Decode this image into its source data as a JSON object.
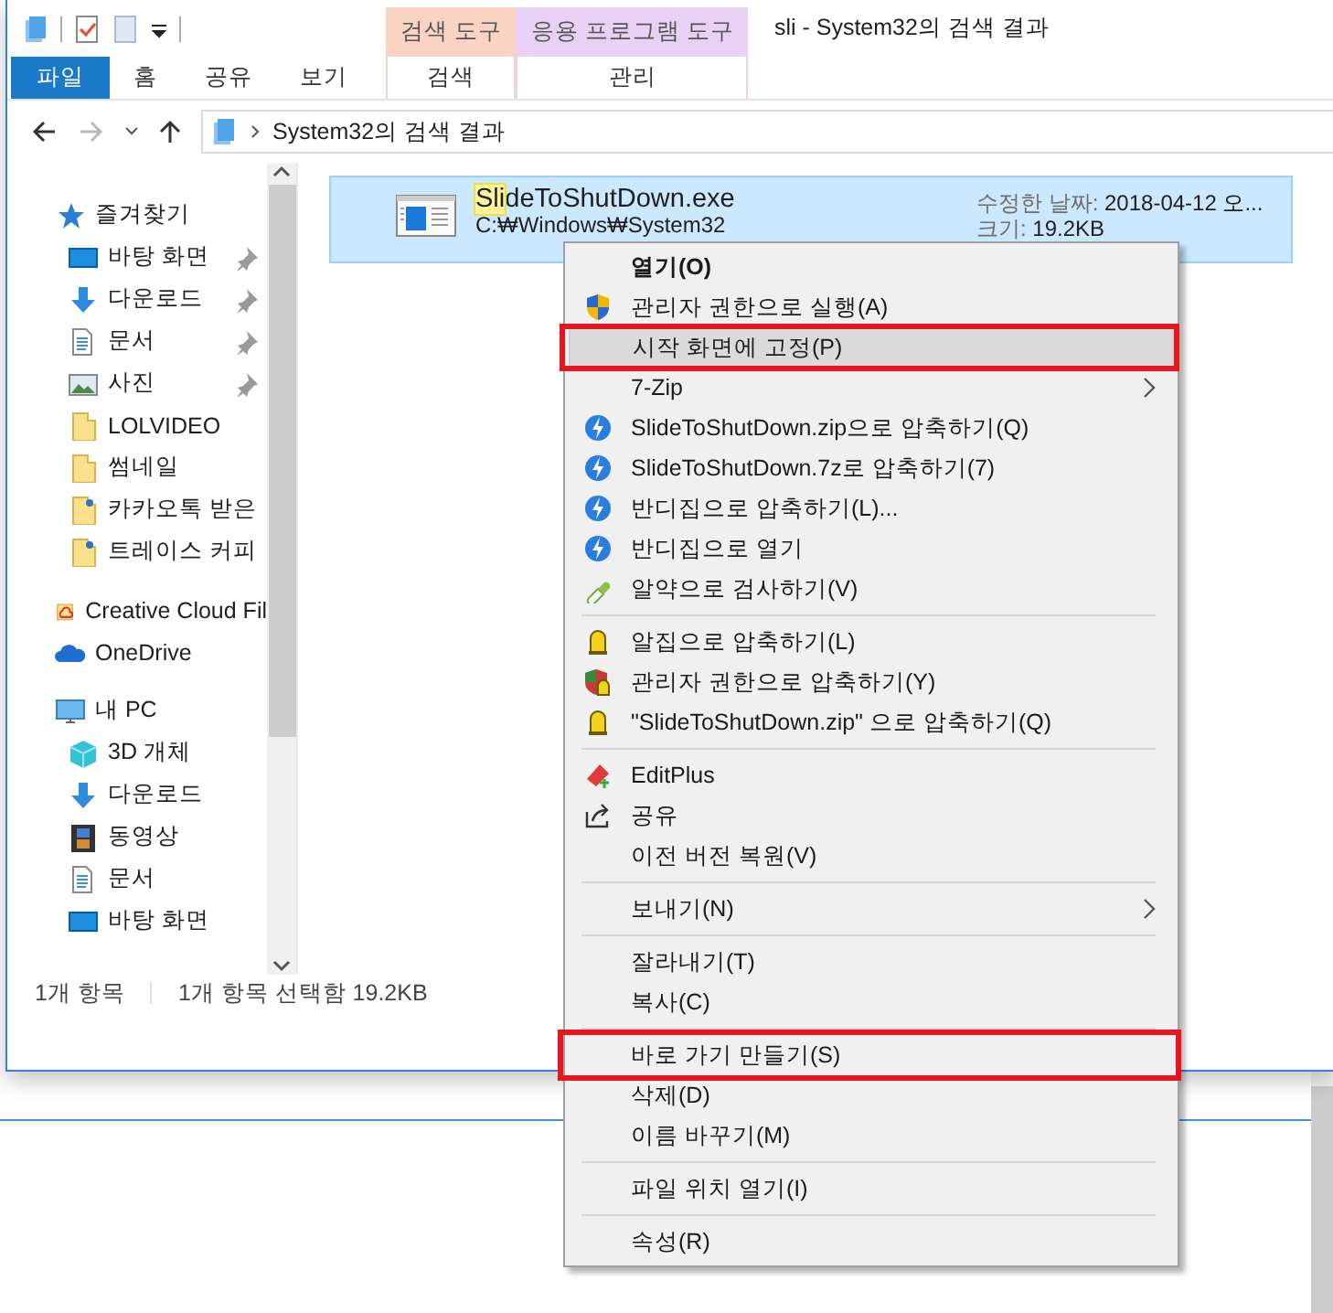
{
  "window": {
    "title": "sli - System32의 검색 결과"
  },
  "ribbon": {
    "tabs": [
      {
        "label": "파일",
        "selected": true
      },
      {
        "label": "홈",
        "selected": false
      },
      {
        "label": "공유",
        "selected": false
      },
      {
        "label": "보기",
        "selected": false
      }
    ],
    "context_groups": [
      {
        "header": "검색 도구",
        "tab": "검색",
        "color": "#f9d4c2"
      },
      {
        "header": "응용 프로그램 도구",
        "tab": "관리",
        "color": "#e9d1f5"
      }
    ]
  },
  "address_bar": {
    "path": "System32의 검색 결과"
  },
  "sidebar": {
    "items": [
      {
        "kind": "star",
        "label": "즐겨찾기",
        "children": [
          {
            "kind": "desktop",
            "label": "바탕 화면",
            "pinned": true
          },
          {
            "kind": "download",
            "label": "다운로드",
            "pinned": true
          },
          {
            "kind": "document",
            "label": "문서",
            "pinned": true
          },
          {
            "kind": "picture",
            "label": "사진",
            "pinned": true
          },
          {
            "kind": "folder",
            "label": "LOLVIDEO",
            "pinned": false
          },
          {
            "kind": "folder",
            "label": "썸네일",
            "pinned": false
          },
          {
            "kind": "shared",
            "label": "카카오톡 받은",
            "pinned": false
          },
          {
            "kind": "shared",
            "label": "트레이스 커피",
            "pinned": false
          }
        ]
      },
      {
        "kind": "creative",
        "label": "Creative Cloud Fil"
      },
      {
        "kind": "onedrive",
        "label": "OneDrive"
      },
      {
        "kind": "pc",
        "label": "내 PC",
        "children": [
          {
            "kind": "cube",
            "label": "3D 개체"
          },
          {
            "kind": "download",
            "label": "다운로드"
          },
          {
            "kind": "video",
            "label": "동영상"
          },
          {
            "kind": "document",
            "label": "문서"
          },
          {
            "kind": "desktop",
            "label": "바탕 화면"
          }
        ]
      }
    ]
  },
  "results": [
    {
      "match": "Sli",
      "rest": "deToShutDown.exe",
      "path": "C:₩Windows₩System32",
      "modified_label": "수정한 날짜:",
      "modified": "2018-04-12 오...",
      "size_label": "크기:",
      "size": "19.2KB",
      "selected": true
    }
  ],
  "status_bar": {
    "item_count": "1개 항목",
    "selection": "1개 항목 선택함 19.2KB"
  },
  "context_menu": [
    {
      "kind": "default",
      "label": "열기(O)",
      "hovered": false,
      "marked": false
    },
    {
      "kind": "shield",
      "label": "관리자 권한으로 실행(A)",
      "hovered": false,
      "marked": false
    },
    {
      "kind": "plain",
      "label": "시작 화면에 고정(P)",
      "hovered": true,
      "marked": true
    },
    {
      "kind": "submenu",
      "label": "7-Zip",
      "hovered": false,
      "marked": false
    },
    {
      "kind": "bandizip",
      "label": "SlideToShutDown.zip으로 압축하기(Q)",
      "hovered": false,
      "marked": false
    },
    {
      "kind": "bandizip",
      "label": "SlideToShutDown.7z로 압축하기(7)",
      "hovered": false,
      "marked": false
    },
    {
      "kind": "bandizip",
      "label": "반디집으로 압축하기(L)...",
      "hovered": false,
      "marked": false
    },
    {
      "kind": "bandizip",
      "label": "반디집으로 열기",
      "hovered": false,
      "marked": false
    },
    {
      "kind": "pill",
      "label": "알약으로 검사하기(V)",
      "hovered": false,
      "marked": false
    },
    {
      "kind": "separator"
    },
    {
      "kind": "alzip",
      "label": "알집으로 압축하기(L)",
      "hovered": false,
      "marked": false
    },
    {
      "kind": "alzipadmin",
      "label": "관리자 권한으로 압축하기(Y)",
      "hovered": false,
      "marked": false
    },
    {
      "kind": "alzip",
      "label": "\"SlideToShutDown.zip\" 으로 압축하기(Q)",
      "hovered": false,
      "marked": false
    },
    {
      "kind": "separator"
    },
    {
      "kind": "editplus",
      "label": "EditPlus",
      "hovered": false,
      "marked": false
    },
    {
      "kind": "share",
      "label": "공유",
      "hovered": false,
      "marked": false
    },
    {
      "kind": "plain",
      "label": "이전 버전 복원(V)",
      "hovered": false,
      "marked": false
    },
    {
      "kind": "separator"
    },
    {
      "kind": "submenu",
      "label": "보내기(N)",
      "hovered": false,
      "marked": false
    },
    {
      "kind": "separator"
    },
    {
      "kind": "plain",
      "label": "잘라내기(T)",
      "hovered": false,
      "marked": false
    },
    {
      "kind": "plain",
      "label": "복사(C)",
      "hovered": false,
      "marked": false
    },
    {
      "kind": "separator"
    },
    {
      "kind": "plain",
      "label": "바로 가기 만들기(S)",
      "hovered": false,
      "marked": true
    },
    {
      "kind": "plain",
      "label": "삭제(D)",
      "hovered": false,
      "marked": false
    },
    {
      "kind": "plain",
      "label": "이름 바꾸기(M)",
      "hovered": false,
      "marked": false
    },
    {
      "kind": "separator"
    },
    {
      "kind": "plain",
      "label": "파일 위치 열기(I)",
      "hovered": false,
      "marked": false
    },
    {
      "kind": "separator"
    },
    {
      "kind": "plain",
      "label": "속성(R)",
      "hovered": false,
      "marked": false
    }
  ]
}
